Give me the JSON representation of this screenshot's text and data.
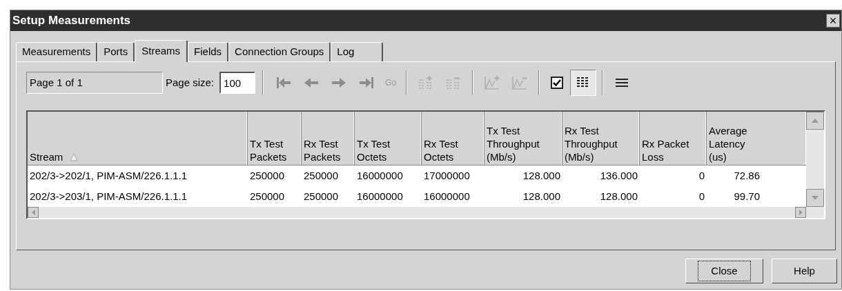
{
  "window": {
    "title": "Setup Measurements",
    "close": "×"
  },
  "tabs": [
    {
      "label": "Measurements",
      "selected": false
    },
    {
      "label": "Ports",
      "selected": false
    },
    {
      "label": "Streams",
      "selected": true
    },
    {
      "label": "Fields",
      "selected": false
    },
    {
      "label": "Connection Groups",
      "selected": false
    },
    {
      "label": "Log",
      "selected": false
    }
  ],
  "toolbar": {
    "page_label": "Page 1 of 1",
    "page_size_label": "Page size:",
    "page_size": "100",
    "go": "Go",
    "tools": [
      {
        "kind": "first",
        "disabled": false
      },
      {
        "kind": "prev",
        "disabled": false
      },
      {
        "kind": "next",
        "disabled": false
      },
      {
        "kind": "last",
        "disabled": false
      },
      {
        "kind": "go",
        "disabled": true
      },
      {
        "kind": "sep"
      },
      {
        "kind": "add-rows",
        "disabled": true
      },
      {
        "kind": "remove-rows",
        "disabled": true
      },
      {
        "kind": "sep"
      },
      {
        "kind": "add-chart",
        "disabled": true
      },
      {
        "kind": "remove-chart",
        "disabled": true
      },
      {
        "kind": "sep"
      },
      {
        "kind": "checkbox",
        "checked": true
      },
      {
        "kind": "grid",
        "pressed": true
      },
      {
        "kind": "sep"
      },
      {
        "kind": "lines",
        "pressed": false
      }
    ]
  },
  "table": {
    "columns": [
      {
        "label": "Stream",
        "sorted": true
      },
      {
        "label": "Tx Test\nPackets"
      },
      {
        "label": "Rx Test\nPackets"
      },
      {
        "label": "Tx Test\nOctets"
      },
      {
        "label": "Rx Test\nOctets"
      },
      {
        "label": "Tx Test\nThroughput\n(Mb/s)"
      },
      {
        "label": "Rx Test\nThroughput\n(Mb/s)"
      },
      {
        "label": "Rx Packet\nLoss"
      },
      {
        "label": "Average\nLatency\n(us)"
      }
    ],
    "rows": [
      [
        "202/3->202/1, PIM-ASM/226.1.1.1",
        "250000",
        "250000",
        "16000000",
        "17000000",
        "128.000",
        "136.000",
        "0",
        "72.86"
      ],
      [
        "202/3->203/1, PIM-ASM/226.1.1.1",
        "250000",
        "250000",
        "16000000",
        "16000000",
        "128.000",
        "128.000",
        "0",
        "99.70"
      ]
    ]
  },
  "buttons": [
    {
      "label": "Close",
      "focused": true
    },
    {
      "label": "Help",
      "focused": false
    }
  ]
}
